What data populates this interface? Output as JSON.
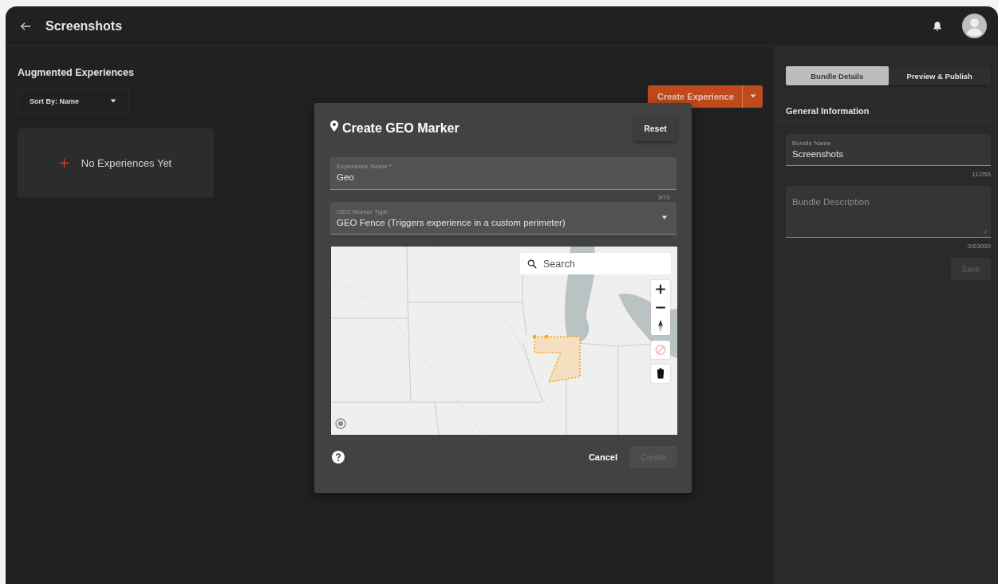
{
  "header": {
    "title": "Screenshots"
  },
  "experiences": {
    "heading": "Augmented Experiences",
    "sort": {
      "value": "Sort By: Name"
    },
    "empty_card": {
      "label": "No Experiences Yet"
    },
    "create_button": {
      "label": "Create Experience"
    }
  },
  "side_panel": {
    "tabs": [
      {
        "label": "Bundle Details",
        "selected": true
      },
      {
        "label": "Preview & Publish",
        "selected": false
      }
    ],
    "section_title": "General Information",
    "fields": [
      {
        "kind": "input",
        "label": "Bundle Name",
        "value": "Screenshots",
        "counter": "11/255"
      },
      {
        "kind": "textarea",
        "placeholder": "Bundle Description",
        "counter": "0/63000"
      }
    ],
    "save_button": {
      "label": "Save",
      "disabled": true
    }
  },
  "dialog": {
    "title": "Create GEO Marker",
    "reset_button": {
      "label": "Reset"
    },
    "name_field": {
      "label": "Experience Name *",
      "value": "Geo",
      "counter": "3/70"
    },
    "type_select": {
      "label": "GEO Marker Type",
      "value": "GEO Fence (Triggers experience in a custom perimeter)"
    },
    "map": {
      "search": {
        "placeholder": "Search"
      }
    },
    "cancel_button": {
      "label": "Cancel"
    },
    "create_button": {
      "label": "Create",
      "disabled": true
    }
  }
}
